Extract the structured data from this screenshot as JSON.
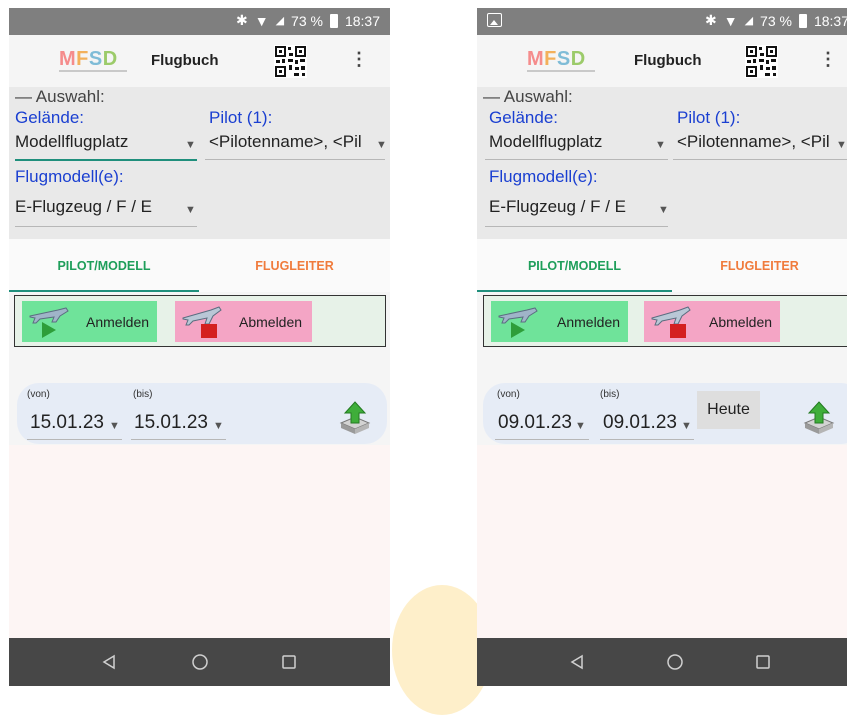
{
  "status_bar": {
    "battery": "73 %",
    "time": "18:37"
  },
  "app": {
    "logo": "MFSD",
    "title": "Flugbuch"
  },
  "selection": {
    "header": "— Auswahl:",
    "site_label": "Gelände:",
    "site_value": "Modellflugplatz",
    "pilot_label": "Pilot (1):",
    "pilot_value": "<Pilotenname>, <Pil",
    "model_label": "Flugmodell(e):",
    "model_value": "E-Flugzeug / F / E"
  },
  "tabs": {
    "pilot_model": "PILOT/MODELL",
    "flight_director": "FLUGLEITER"
  },
  "actions": {
    "checkin": "Anmelden",
    "checkout": "Abmelden"
  },
  "date_filter": {
    "from_label": "(von)",
    "to_label": "(bis)",
    "today_button": "Heute"
  },
  "screens": [
    {
      "from": "15.01.23",
      "to": "15.01.23"
    },
    {
      "from": "09.01.23",
      "to": "09.01.23"
    }
  ],
  "colors": {
    "accent": "#1f8f7c",
    "label_blue": "#1a3fd1",
    "tab_green": "#1e9e5a",
    "tab_orange": "#f07b3c"
  }
}
